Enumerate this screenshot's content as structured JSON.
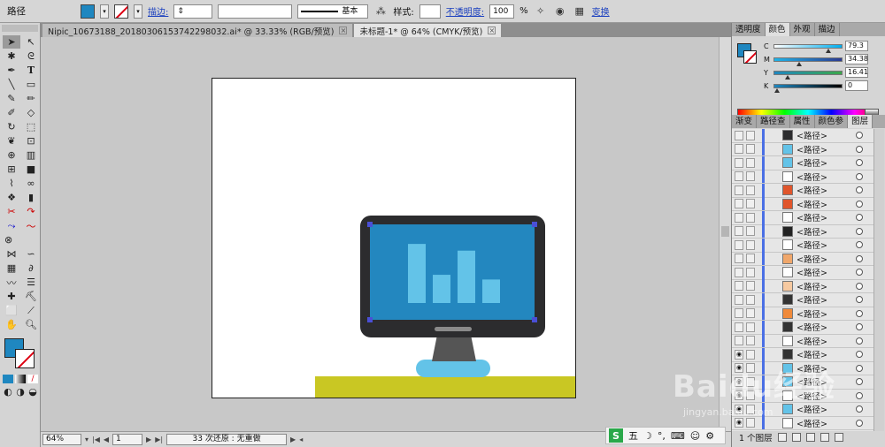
{
  "control_bar": {
    "object_type": "路径",
    "stroke_label": "描边:",
    "stroke_profile": "基本",
    "style_label": "样式:",
    "opacity_label": "不透明度:",
    "opacity_value": "100",
    "opacity_unit": "%",
    "transform_label": "变换",
    "fill_color": "#1f87c0"
  },
  "tabs": [
    {
      "label": "Nipic_10673188_20180306153742298032.ai* @ 33.33% (RGB/预览)"
    },
    {
      "label": "未标题-1* @ 64% (CMYK/预览)"
    }
  ],
  "artwork": {
    "monitor_frame_color": "#2c2c2e",
    "screen_color": "#2387bf",
    "bar_color": "#63c3e8",
    "bars": [
      0.88,
      0.42,
      0.78,
      0.35
    ],
    "stand_color": "#555555",
    "base_color": "#63c3e8",
    "desk_color": "#c9c723",
    "anchor_color": "#4a4fd6"
  },
  "status_bar": {
    "zoom": "64%",
    "page": "1",
    "info": "33 次还原 : 无重做"
  },
  "color_panel": {
    "tabs": [
      "透明度",
      "颜色",
      "外观",
      "描边"
    ],
    "channels": [
      {
        "name": "C",
        "value": "79.3",
        "pos": 0.79
      },
      {
        "name": "M",
        "value": "34.38",
        "pos": 0.34
      },
      {
        "name": "Y",
        "value": "16.41",
        "pos": 0.16
      },
      {
        "name": "K",
        "value": "0",
        "pos": 0.0
      }
    ]
  },
  "layers_panel": {
    "tabs": [
      "渐变",
      "路径查",
      "属性",
      "颜色参",
      "图层"
    ],
    "rows": [
      "<路径>",
      "<路径>",
      "<路径>",
      "<路径>",
      "<路径>",
      "<路径>",
      "<路径>",
      "<路径>",
      "<路径>",
      "<路径>",
      "<路径>",
      "<路径>",
      "<路径>",
      "<路径>",
      "<路径>",
      "<路径>",
      "<路径>",
      "<路径>",
      "<路径>",
      "<路径>",
      "<路径>",
      "<路径>"
    ],
    "footer": "1 个图层"
  },
  "ime": {
    "label": "五"
  },
  "watermark": {
    "logo": "Baidu经验",
    "url": "jingyan.baidu.com"
  }
}
